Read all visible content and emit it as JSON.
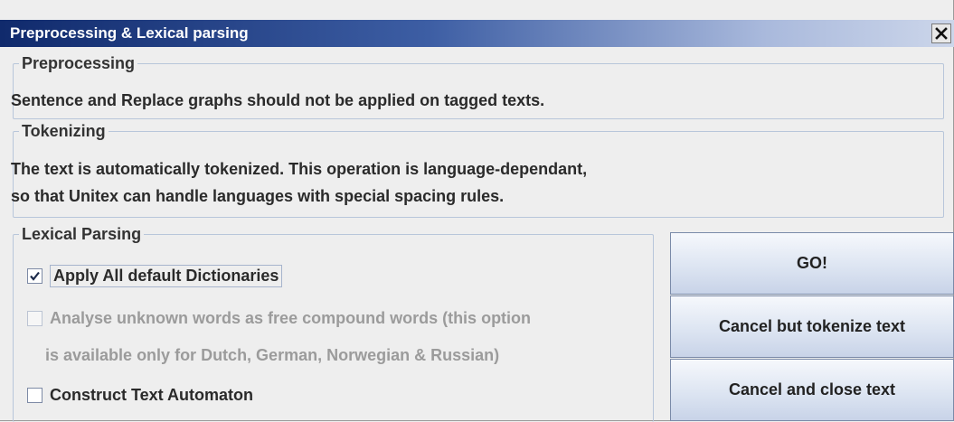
{
  "window": {
    "title": "Preprocessing & Lexical parsing"
  },
  "preprocessing": {
    "legend": "Preprocessing",
    "text": "Sentence and Replace graphs should not be applied on tagged texts."
  },
  "tokenizing": {
    "legend": "Tokenizing",
    "line1": "The text is automatically tokenized. This operation is language-dependant,",
    "line2": "so that Unitex can handle languages with special spacing rules."
  },
  "lexical_parsing": {
    "legend": "Lexical Parsing",
    "options": [
      {
        "label": "Apply All default Dictionaries",
        "checked": true,
        "enabled": true
      },
      {
        "label": "Analyse unknown words as free compound words (this option",
        "checked": false,
        "enabled": false
      },
      {
        "label": "Construct Text Automaton",
        "checked": false,
        "enabled": true
      }
    ],
    "option2_continuation": "is available only for Dutch, German, Norwegian & Russian)"
  },
  "buttons": {
    "go": "GO!",
    "cancel_tokenize": "Cancel but tokenize text",
    "cancel_close": "Cancel and close text"
  },
  "colors": {
    "title_gradient_start": "#102a6c",
    "title_gradient_end": "#ccd6ea",
    "window_bg": "#eeeeee",
    "disabled_text": "#9b9b9b"
  }
}
